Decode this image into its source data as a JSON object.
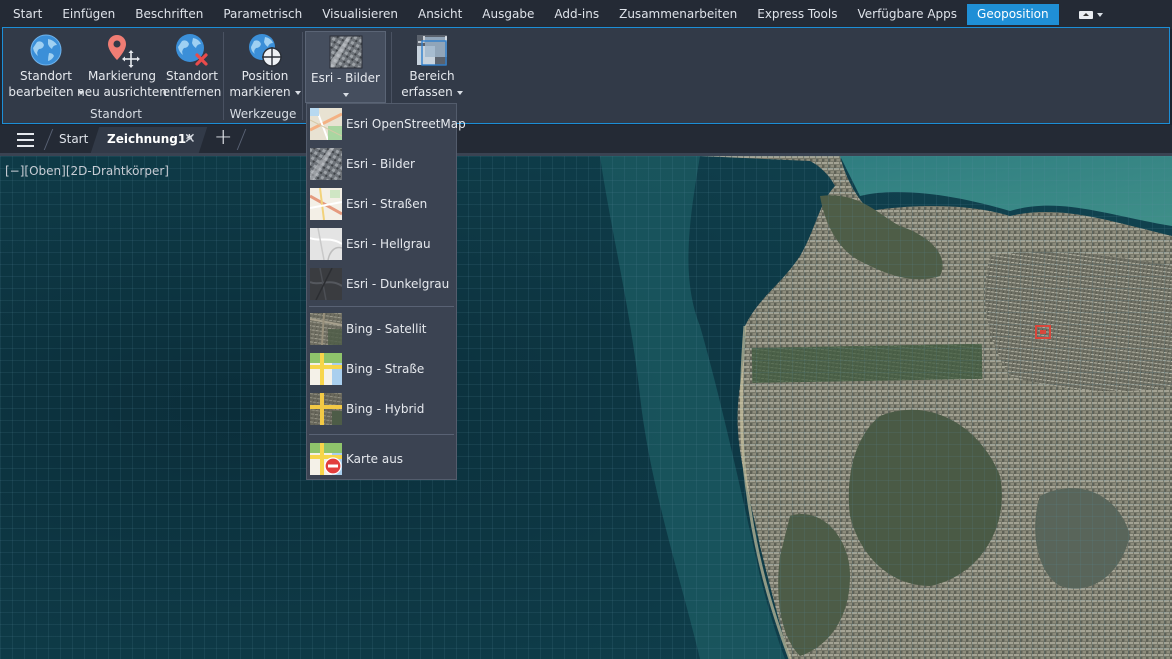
{
  "menu": {
    "tabs": [
      "Start",
      "Einfügen",
      "Beschriften",
      "Parametrisch",
      "Visualisieren",
      "Ansicht",
      "Ausgabe",
      "Add-ins",
      "Zusammenarbeiten",
      "Express Tools",
      "Verfügbare Apps",
      "Geoposition"
    ],
    "active_tab": "Geoposition"
  },
  "ribbon": {
    "standort": {
      "title": "Standort",
      "bearbeiten": [
        "Standort",
        "bearbeiten"
      ],
      "ausrichten": [
        "Markierung",
        "neu ausrichten"
      ],
      "entfernen": [
        "Standort",
        "entfernen"
      ]
    },
    "werkzeuge": {
      "title": "Werkzeuge",
      "position": [
        "Position",
        "markieren"
      ]
    },
    "karte": {
      "label": "Esri - Bilder"
    },
    "bereich": {
      "label": [
        "Bereich",
        "erfassen"
      ]
    }
  },
  "file_tabs": {
    "start": "Start",
    "drawing": "Zeichnung1*"
  },
  "viewport": {
    "label": "[−][Oben][2D-Drahtkörper]"
  },
  "map_menu": {
    "items": [
      {
        "label": "Esri OpenStreetMap",
        "icon": "osm-thumb-icon"
      },
      {
        "label": "Esri - Bilder",
        "icon": "imagery-thumb-icon"
      },
      {
        "label": "Esri - Straßen",
        "icon": "streets-thumb-icon"
      },
      {
        "label": "Esri - Hellgrau",
        "icon": "lightgray-thumb-icon"
      },
      {
        "label": "Esri - Dunkelgrau",
        "icon": "darkgray-thumb-icon"
      },
      {
        "label": "Bing - Satellit",
        "icon": "bing-satellite-thumb-icon"
      },
      {
        "label": "Bing - Straße",
        "icon": "bing-road-thumb-icon"
      },
      {
        "label": "Bing - Hybrid",
        "icon": "bing-hybrid-thumb-icon"
      },
      {
        "label": "Karte aus",
        "icon": "map-off-icon"
      }
    ]
  },
  "colors": {
    "accent": "#1f8fd6",
    "ribbon_bg": "#323a48",
    "menubar_bg": "#242a35",
    "ocean": "#0e3844"
  }
}
